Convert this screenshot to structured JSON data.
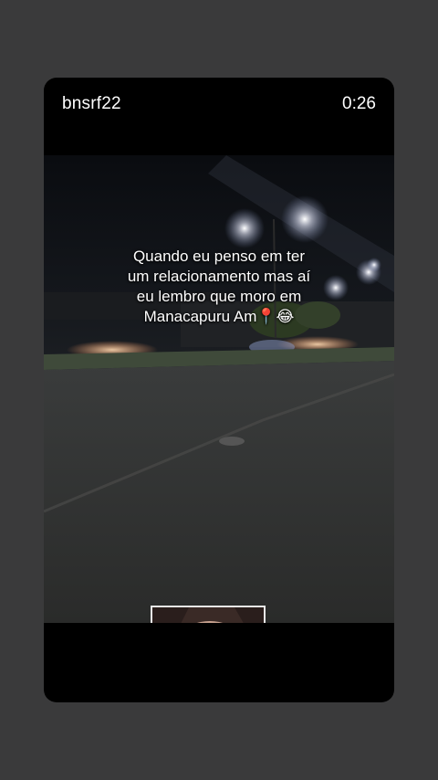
{
  "post": {
    "username": "bnsrf22",
    "timer": "0:26"
  },
  "caption": {
    "line1": "Quando eu penso em ter",
    "line2": "um relacionamento mas aí",
    "line3": "eu lembro que moro em",
    "line4": "Manacapuru Am📍😂"
  },
  "colors": {
    "page_bg": "#3a3a3b",
    "card_bg": "#000000",
    "text": "#ffffff"
  },
  "icons": {
    "pin": "round-pushpin",
    "laugh": "face-with-tears-of-joy"
  }
}
